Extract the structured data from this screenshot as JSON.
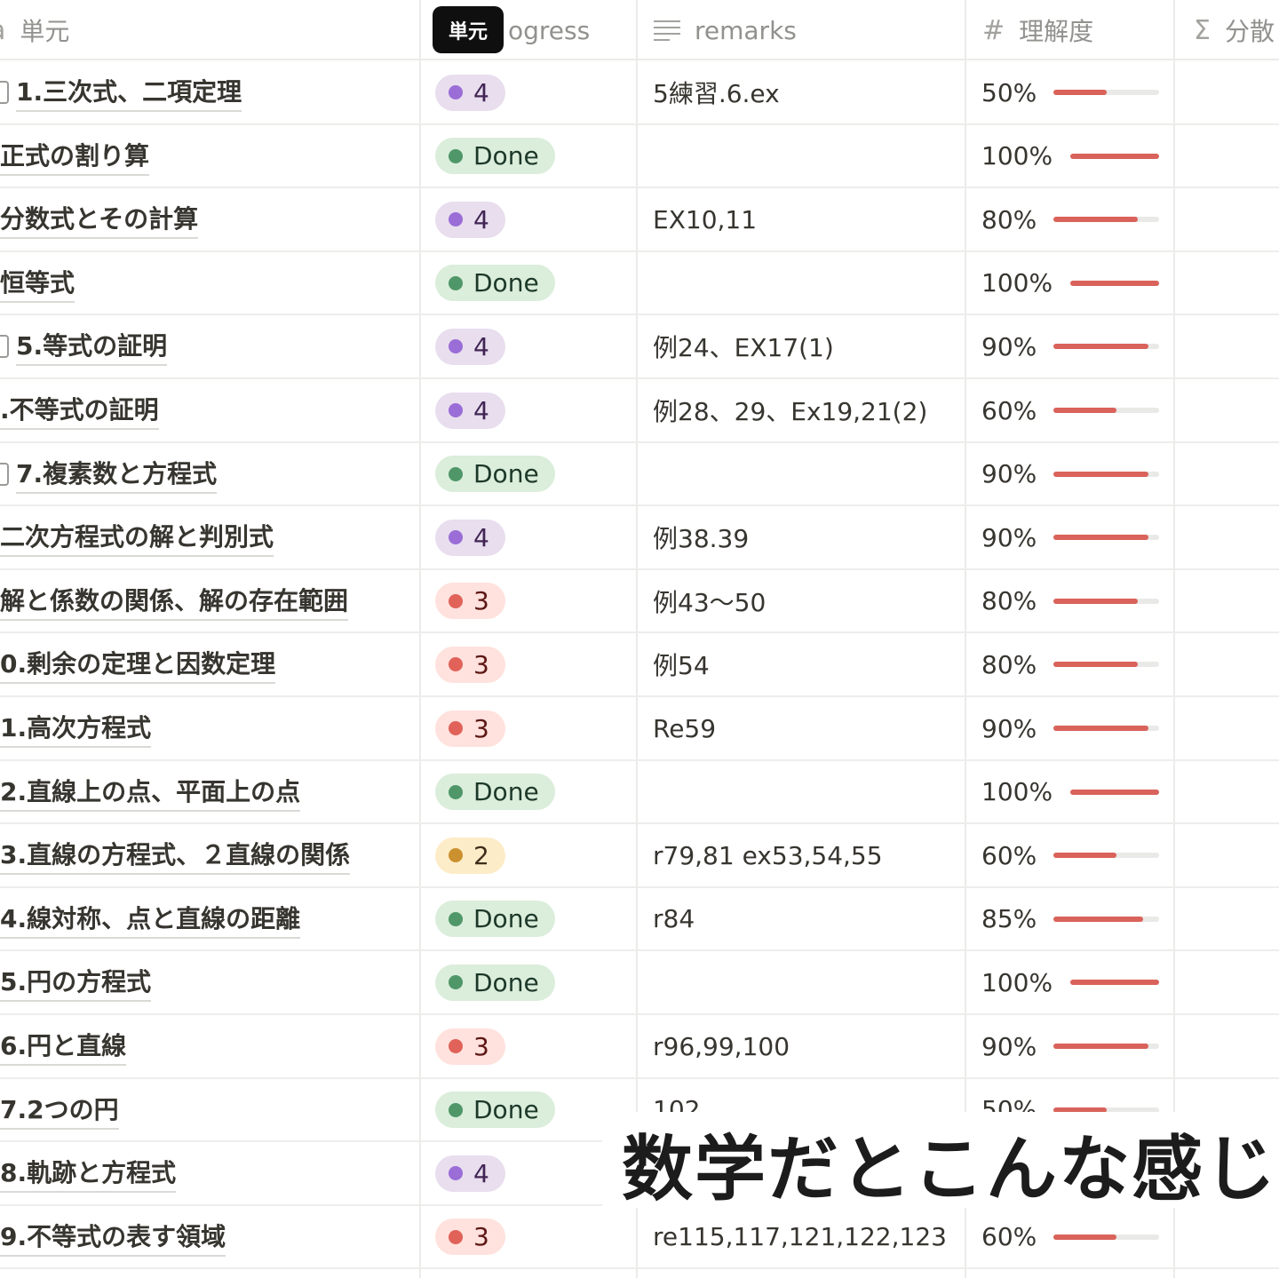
{
  "header": {
    "name_col": "単元",
    "name_icon": "text-icon",
    "name_icon_glyph": "a",
    "progress_col": "ogress",
    "remarks_col": "remarks",
    "remarks_icon": "lines-icon",
    "understanding_col": "理解度",
    "understanding_icon_glyph": "#",
    "variance_col": "分散",
    "variance_icon_glyph": "Σ"
  },
  "tooltip": {
    "text": "単元"
  },
  "status_colors": {
    "purple": {
      "bg": "#e8deee",
      "dot": "#9a6dd7",
      "text": "#412454"
    },
    "green": {
      "bg": "#dbeddb",
      "dot": "#4f9768",
      "text": "#1c3829"
    },
    "red": {
      "bg": "#ffe2dd",
      "dot": "#e16259",
      "text": "#5d1715"
    },
    "yellow": {
      "bg": "#fdecc8",
      "dot": "#cb912f",
      "text": "#402c1b"
    }
  },
  "rows": [
    {
      "name": "1.三次式、二項定理",
      "page_icon": true,
      "progress": "4",
      "color": "purple",
      "remarks": "5練習.6.ex",
      "understanding": "50%",
      "value": 0.5
    },
    {
      "name": "正式の割り算",
      "page_icon": false,
      "progress": "Done",
      "color": "green",
      "remarks": "",
      "understanding": "100%",
      "value": 1.0
    },
    {
      "name": "分数式とその計算",
      "page_icon": false,
      "progress": "4",
      "color": "purple",
      "remarks": "EX10,11",
      "understanding": "80%",
      "value": 0.8
    },
    {
      "name": "恒等式",
      "page_icon": false,
      "progress": "Done",
      "color": "green",
      "remarks": "",
      "understanding": "100%",
      "value": 1.0
    },
    {
      "name": "5.等式の証明",
      "page_icon": true,
      "progress": "4",
      "color": "purple",
      "remarks": "例24、EX17(1)",
      "understanding": "90%",
      "value": 0.9
    },
    {
      "name": ".不等式の証明",
      "page_icon": false,
      "progress": "4",
      "color": "purple",
      "remarks": "例28、29、Ex19,21(2)",
      "understanding": "60%",
      "value": 0.6
    },
    {
      "name": "7.複素数と方程式",
      "page_icon": true,
      "progress": "Done",
      "color": "green",
      "remarks": "",
      "understanding": "90%",
      "value": 0.9
    },
    {
      "name": "二次方程式の解と判別式",
      "page_icon": false,
      "progress": "4",
      "color": "purple",
      "remarks": "例38.39",
      "understanding": "90%",
      "value": 0.9
    },
    {
      "name": "解と係数の関係、解の存在範囲",
      "page_icon": false,
      "progress": "3",
      "color": "red",
      "remarks": "例43〜50",
      "understanding": "80%",
      "value": 0.8
    },
    {
      "name": "0.剰余の定理と因数定理",
      "page_icon": false,
      "progress": "3",
      "color": "red",
      "remarks": "例54",
      "understanding": "80%",
      "value": 0.8
    },
    {
      "name": "1.高次方程式",
      "page_icon": false,
      "progress": "3",
      "color": "red",
      "remarks": "Re59",
      "understanding": "90%",
      "value": 0.9
    },
    {
      "name": "2.直線上の点、平面上の点",
      "page_icon": false,
      "progress": "Done",
      "color": "green",
      "remarks": "",
      "understanding": "100%",
      "value": 1.0
    },
    {
      "name": "3.直線の方程式、２直線の関係",
      "page_icon": false,
      "progress": "2",
      "color": "yellow",
      "remarks": "r79,81 ex53,54,55",
      "understanding": "60%",
      "value": 0.6
    },
    {
      "name": "4.線対称、点と直線の距離",
      "page_icon": false,
      "progress": "Done",
      "color": "green",
      "remarks": "r84",
      "understanding": "85%",
      "value": 0.85
    },
    {
      "name": "5.円の方程式",
      "page_icon": false,
      "progress": "Done",
      "color": "green",
      "remarks": "",
      "understanding": "100%",
      "value": 1.0
    },
    {
      "name": "6.円と直線",
      "page_icon": false,
      "progress": "3",
      "color": "red",
      "remarks": "r96,99,100",
      "understanding": "90%",
      "value": 0.9
    },
    {
      "name": "7.2つの円",
      "page_icon": false,
      "progress": "Done",
      "color": "green",
      "remarks": "102",
      "understanding": "50%",
      "value": 0.5
    },
    {
      "name": "8.軌跡と方程式",
      "page_icon": false,
      "progress": "4",
      "color": "purple",
      "remarks": "",
      "understanding": "",
      "value": null
    },
    {
      "name": "9.不等式の表す領域",
      "page_icon": false,
      "progress": "3",
      "color": "red",
      "remarks": "re115,117,121,122,123",
      "understanding": "60%",
      "value": 0.6
    }
  ],
  "caption": "数学だとこんな感じ"
}
